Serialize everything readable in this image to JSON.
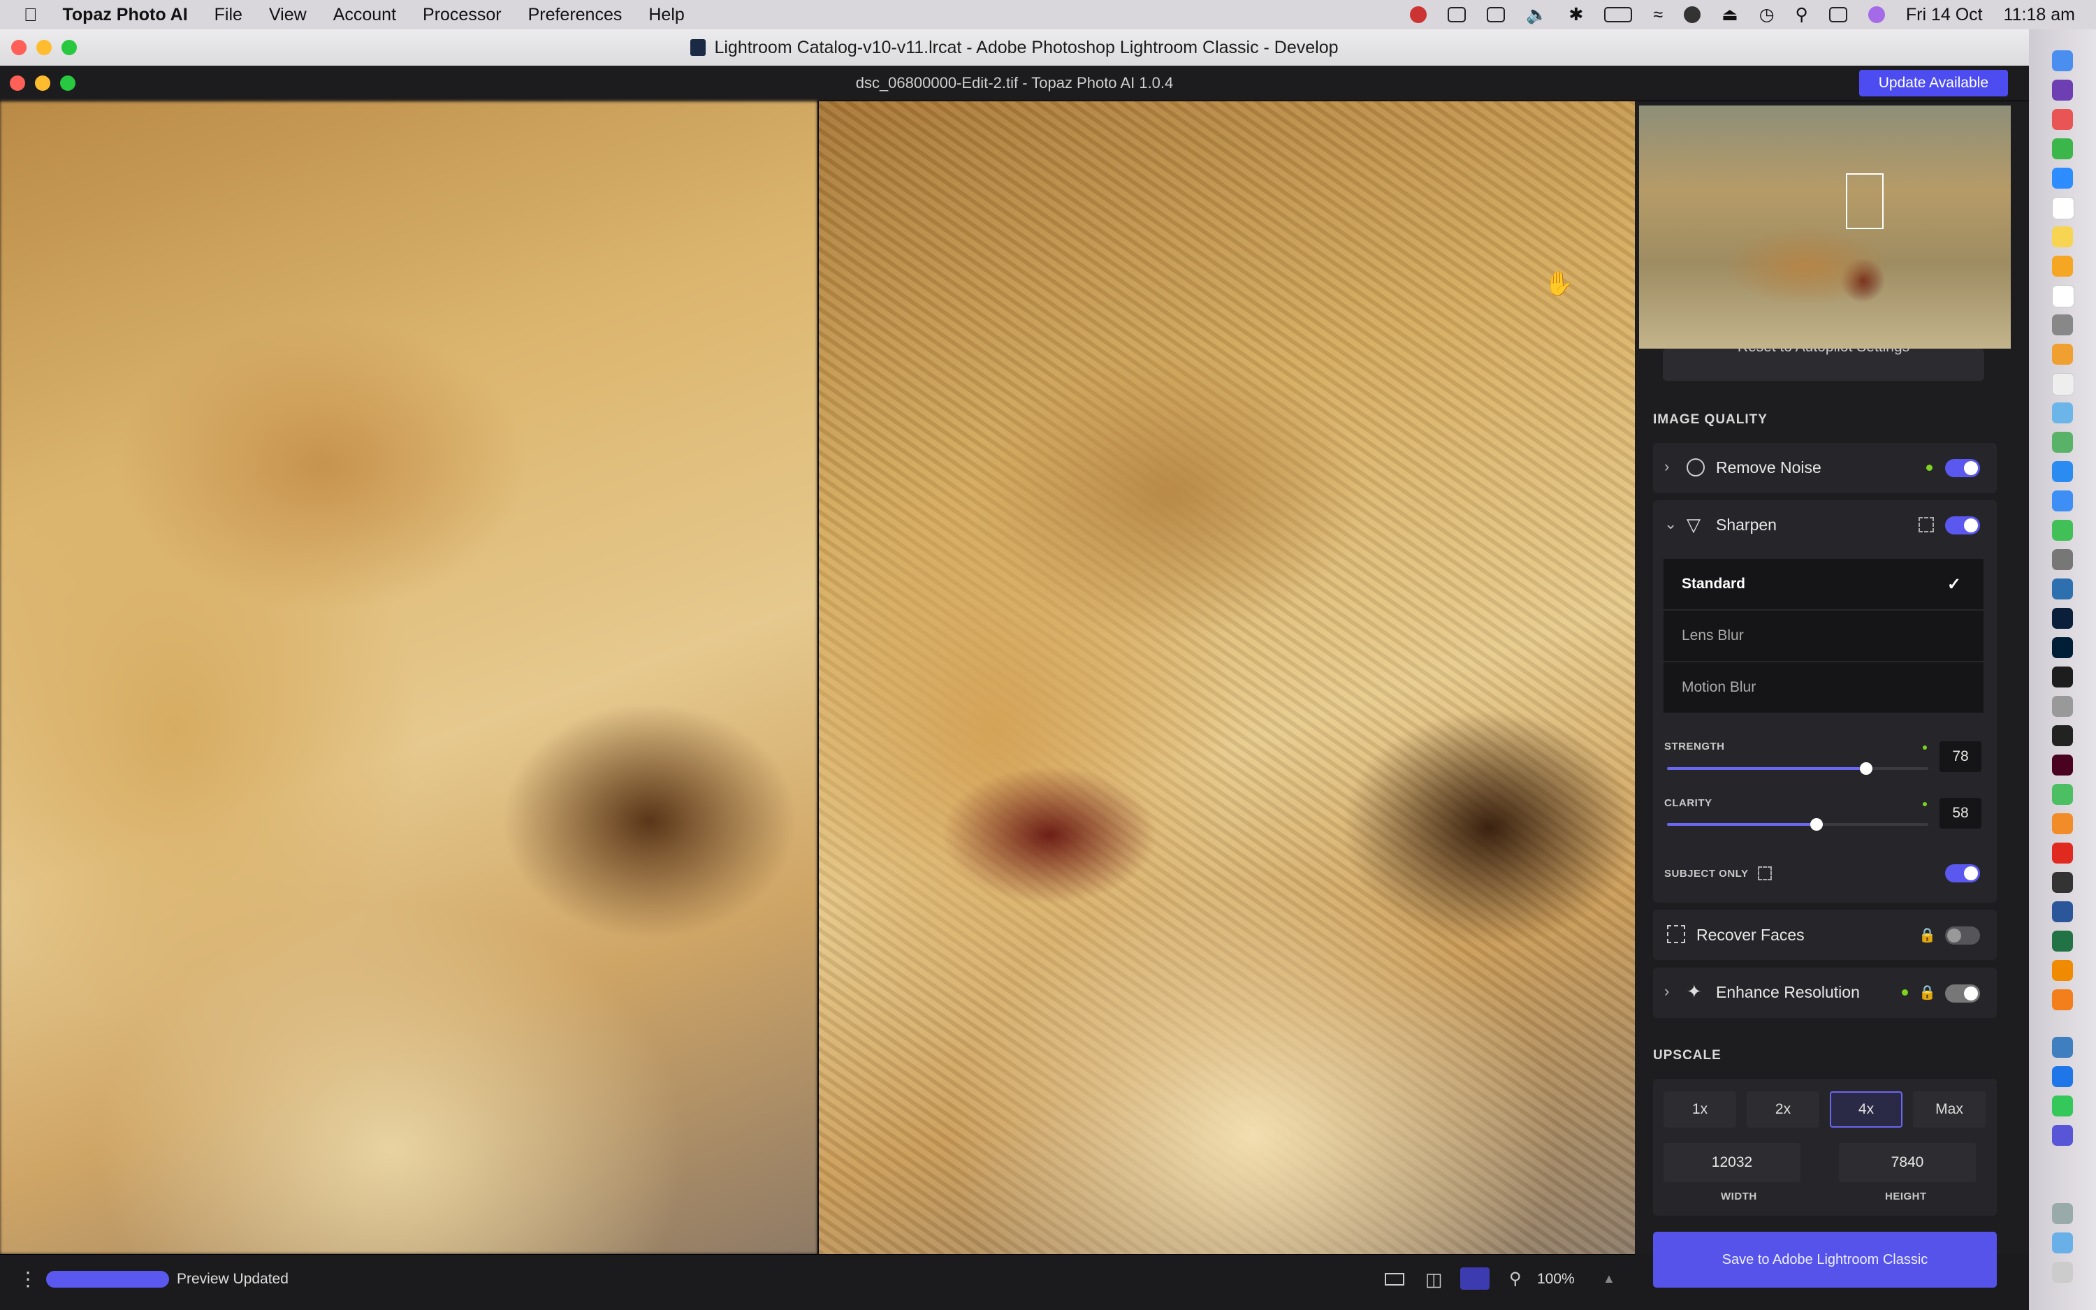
{
  "menubar": {
    "app_name": "Topaz Photo AI",
    "items": [
      "File",
      "View",
      "Account",
      "Processor",
      "Preferences",
      "Help"
    ],
    "date": "Fri 14 Oct",
    "time": "11:18 am"
  },
  "lightroom_window": {
    "title": "Lightroom Catalog-v10-v11.lrcat - Adobe Photoshop Lightroom Classic - Develop"
  },
  "topaz_window": {
    "title": "dsc_06800000-Edit-2.tif - Topaz Photo AI 1.0.4",
    "update_button": "Update Available"
  },
  "sidebar": {
    "reset_autopilot": "Reset to Autopilot Settings",
    "image_quality_title": "IMAGE QUALITY",
    "remove_noise": {
      "label": "Remove Noise",
      "enabled": true
    },
    "sharpen": {
      "label": "Sharpen",
      "enabled": true,
      "models": [
        "Standard",
        "Lens Blur",
        "Motion Blur"
      ],
      "selected_model": "Standard",
      "strength_label": "STRENGTH",
      "strength_value": "78",
      "clarity_label": "CLARITY",
      "clarity_value": "58",
      "subject_only_label": "SUBJECT ONLY",
      "subject_only": true
    },
    "recover_faces": {
      "label": "Recover Faces",
      "enabled": false
    },
    "enhance_resolution": {
      "label": "Enhance Resolution",
      "enabled": true
    },
    "upscale_title": "UPSCALE",
    "upscale_options": [
      "1x",
      "2x",
      "4x",
      "Max"
    ],
    "upscale_selected": "4x",
    "width_value": "12032",
    "height_value": "7840",
    "width_label": "WIDTH",
    "height_label": "HEIGHT",
    "save_button": "Save to Adobe Lightroom Classic"
  },
  "bottom_bar": {
    "status": "Preview Updated",
    "zoom": "100%"
  },
  "colors": {
    "accent": "#5553ea",
    "panel": "#1d1d20",
    "status_dot": "#7ed321"
  }
}
